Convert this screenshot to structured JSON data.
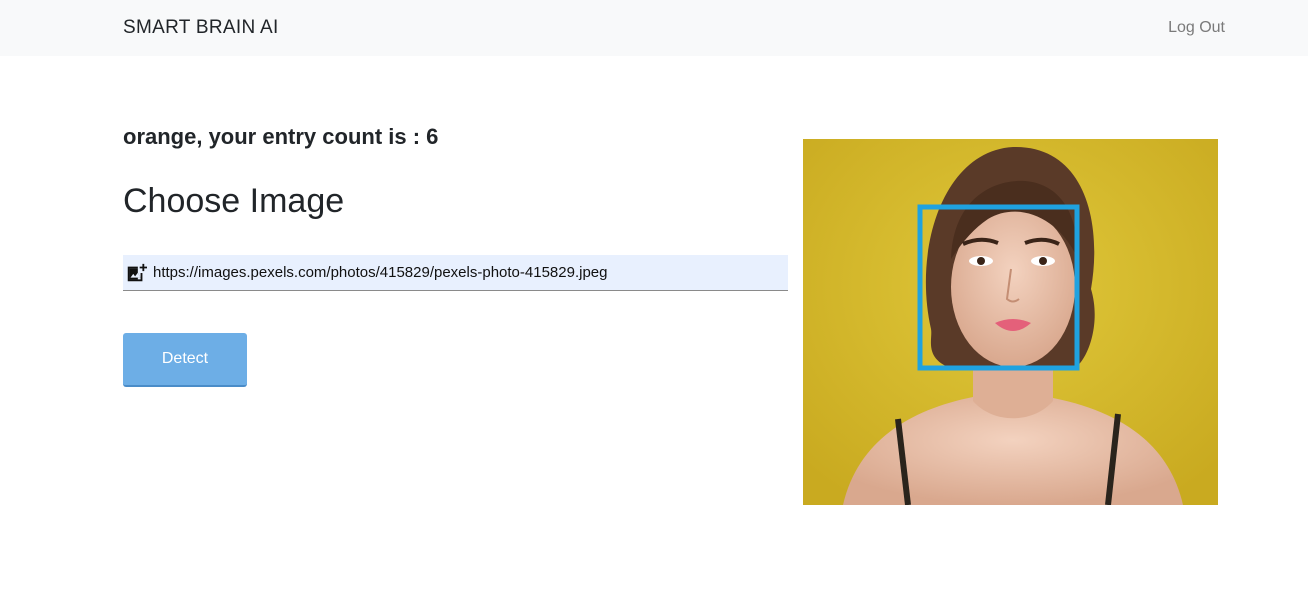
{
  "header": {
    "brand": "SMART BRAIN AI",
    "logout_label": "Log Out"
  },
  "main": {
    "entry_text": "orange, your entry count is : 6",
    "heading": "Choose Image",
    "url_input": {
      "value": "https://images.pexels.com/photos/415829/pexels-photo-415829.jpeg",
      "icon": "add-photo-icon"
    },
    "detect_label": "Detect"
  },
  "image": {
    "description_icon": "detected-face-photo",
    "face_box_color": "#1fa2e0"
  },
  "colors": {
    "accent_button": "#6daee6",
    "navbar_bg": "#f8f9fa",
    "input_bg": "#e8f0fe"
  }
}
